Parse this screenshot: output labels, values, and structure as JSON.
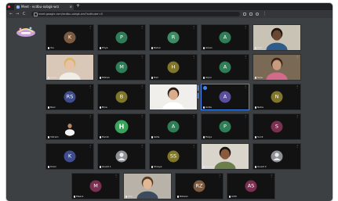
{
  "browser": {
    "tab_title": "Meet - ecdbu-oxbgk-wrz",
    "tab_close": "×",
    "new_tab": "+",
    "url": "meet.google.com/ecdbu-oxbgk-wrz?authuser=0",
    "back": "←",
    "forward": "→",
    "reload": "C"
  },
  "colors": {
    "accent": "#4285f4",
    "page_bg": "#3c4043",
    "tile_bg": "#121212"
  },
  "tiles": [
    {
      "initials": "K",
      "color": "#7b5a40",
      "mic": "You"
    },
    {
      "initials": "P",
      "color": "#2e7d57",
      "mic": "Priya"
    },
    {
      "initials": "R",
      "color": "#3e8a62",
      "mic": "Rahul"
    },
    {
      "initials": "A",
      "color": "#2e7d57",
      "mic": "Aman"
    },
    {
      "mic": "Kofi"
    },
    {
      "mic": "Anna"
    },
    {
      "initials": "M",
      "color": "#2e7d57",
      "mic": "Mohan"
    },
    {
      "initials": "H",
      "color": "#80762b",
      "mic": "Hari"
    },
    {
      "initials": "A",
      "color": "#2e7d57",
      "mic": "Arjun"
    },
    {
      "mic": "Sara"
    },
    {
      "initials": "RS",
      "color": "#3f4d8c",
      "mic": "Ravi"
    },
    {
      "initials": "B",
      "color": "#80762b",
      "mic": "Bina"
    },
    {
      "mic": "Emma"
    },
    {
      "initials": "A",
      "color": "#5a4d9c",
      "mic": "Anita"
    },
    {
      "initials": "N",
      "color": "#80762b",
      "mic": "Neha"
    },
    {
      "mic": "Vikram"
    },
    {
      "initials": "H",
      "color": "#3aa35a",
      "mic": "Harsh"
    },
    {
      "initials": "A",
      "color": "#2e7d57",
      "mic": "Asha"
    },
    {
      "initials": "P",
      "color": "#2e7d57",
      "mic": "Pooja"
    },
    {
      "initials": "S",
      "color": "#7a3050",
      "mic": "Sunil"
    },
    {
      "initials": "K",
      "color": "#3f4d8c",
      "mic": "Kiran"
    },
    {
      "mic": "Guest 1"
    },
    {
      "initials": "SS",
      "color": "#80762b",
      "mic": "Shreya"
    },
    {
      "mic": "Deepak"
    },
    {
      "mic": "Guest 2"
    },
    {
      "initials": "M",
      "color": "#7a3050",
      "mic": "Meera"
    },
    {
      "mic": "Tom"
    },
    {
      "initials": "RZ",
      "color": "#7b5a40",
      "mic": "Rizwan"
    },
    {
      "initials": "AS",
      "color": "#7a3050",
      "mic": "Aditi"
    }
  ]
}
